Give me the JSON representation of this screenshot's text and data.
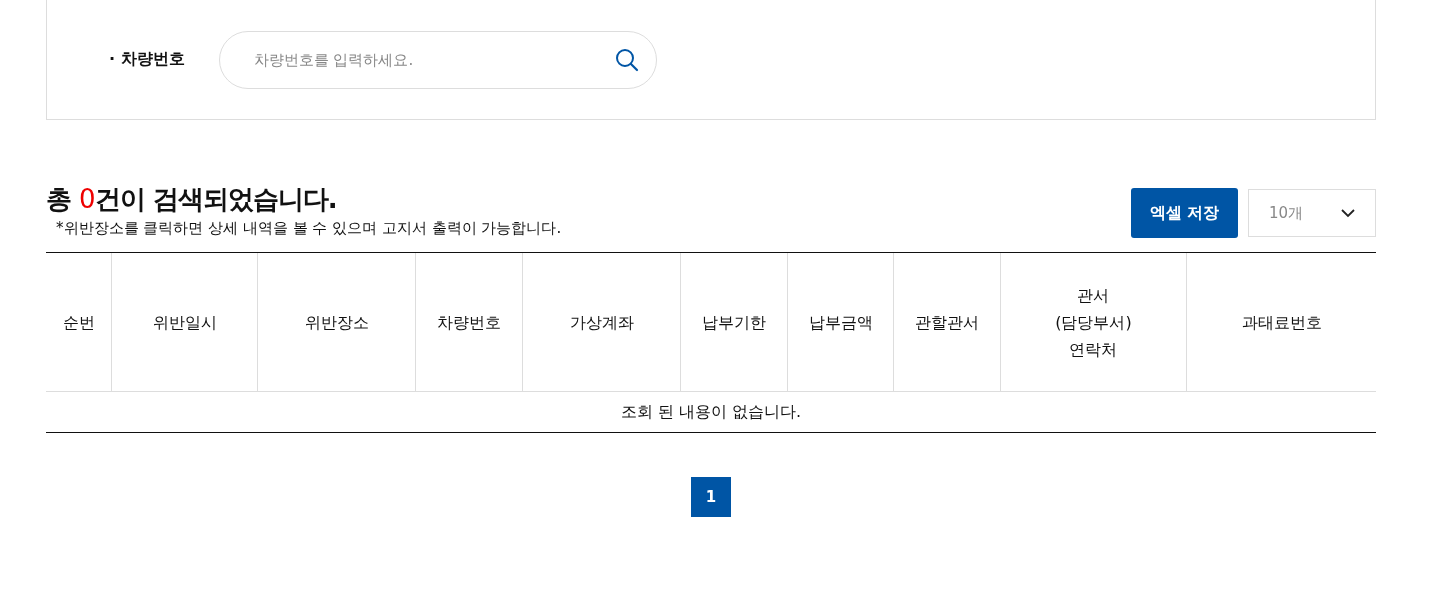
{
  "search": {
    "label": "· 차량번호",
    "placeholder": "차량번호를 입력하세요."
  },
  "result": {
    "title_prefix": "총 ",
    "count": "0",
    "title_suffix": "건이 검색되었습니다.",
    "note": "*위반장소를 클릭하면 상세 내역을 볼 수 있으며 고지서 출력이 가능합니다."
  },
  "excel_button": "엑셀 저장",
  "page_size": {
    "value": "10개"
  },
  "table": {
    "columns": [
      "순번",
      "위반일시",
      "위반장소",
      "차량번호",
      "가상계좌",
      "납부기한",
      "납부금액",
      "관할관서",
      "관서\n(담당부서)\n연락처",
      "과태료번호"
    ],
    "empty_message": "조회 된 내용이 없습니다."
  },
  "pagination": [
    {
      "label": "1",
      "selected": true
    }
  ]
}
